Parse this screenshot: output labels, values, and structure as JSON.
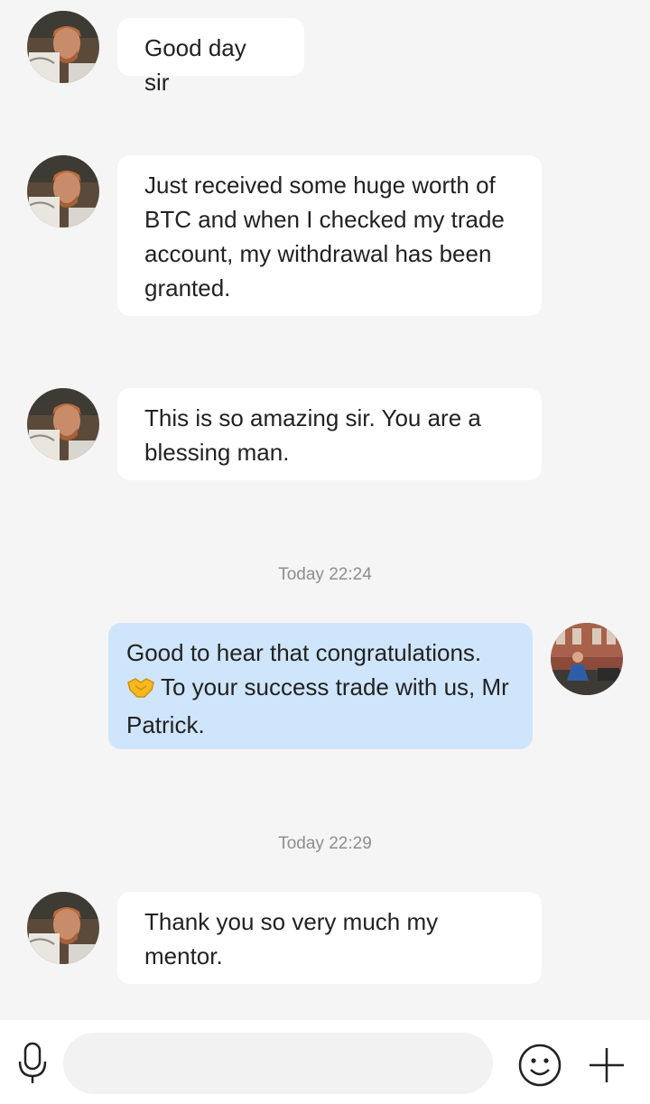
{
  "messages": [
    {
      "text": "Good day sir"
    },
    {
      "text": "Just received some huge worth of BTC and when I checked my trade account, my withdrawal has been granted."
    },
    {
      "text": "This is so amazing sir. You are a blessing man."
    },
    {
      "timestamp": "Today 22:24"
    },
    {
      "text": "To your success trade with us, Mr Patrick.",
      "line1": "Good to hear that congratulations.",
      "emoji": "handshake-icon"
    },
    {
      "timestamp": "Today 22:29"
    },
    {
      "text": "Thank you so very much my mentor."
    }
  ],
  "input": {
    "placeholder": "",
    "value": ""
  },
  "colors": {
    "background": "#f5f5f5",
    "incoming_bubble": "#ffffff",
    "outgoing_bubble": "#cfe5fb",
    "timestamp": "#8e8e8e"
  },
  "icons": {
    "left": "microphone-icon",
    "emoji": "smiley-icon",
    "add": "plus-icon"
  }
}
